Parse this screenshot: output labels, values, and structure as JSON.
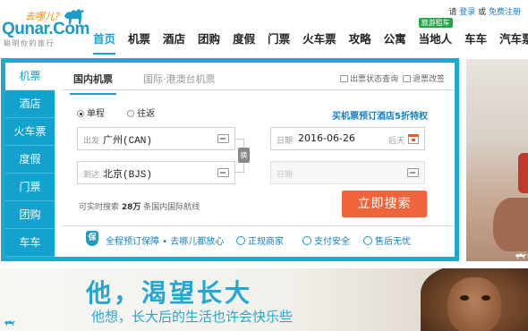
{
  "brand": {
    "slogan": "去哪儿?",
    "name": "Qunar.Com",
    "tagline": "聪明你的旅行"
  },
  "top_links": {
    "prefix": "请",
    "login": "登录",
    "or": "或",
    "register": "免费注册"
  },
  "nav": {
    "items": [
      {
        "label": "首页",
        "active": true
      },
      {
        "label": "机票"
      },
      {
        "label": "酒店"
      },
      {
        "label": "团购"
      },
      {
        "label": "度假"
      },
      {
        "label": "门票"
      },
      {
        "label": "火车票"
      },
      {
        "label": "攻略"
      },
      {
        "label": "公寓"
      },
      {
        "label": "当地人",
        "badge": "旅游租车"
      },
      {
        "label": "车车"
      },
      {
        "label": "汽车票"
      }
    ]
  },
  "side_nav": [
    "机票",
    "酒店",
    "火车票",
    "度假",
    "门票",
    "团购",
    "车车"
  ],
  "tabs": {
    "domestic": "国内机票",
    "international": "国际·港澳台机票",
    "status_query": "出票状态查询",
    "refund": "退票改签"
  },
  "trip_type": {
    "one_way": "单程",
    "round_trip": "往返",
    "selected": "单程"
  },
  "promo_link": "买机票预订酒店5折特权",
  "search_form": {
    "from_label": "出发",
    "from_value": "广州(CAN)",
    "to_label": "到达",
    "to_value": "北京(BJS)",
    "swap_label": "换",
    "depart_label": "日期",
    "depart_value": "2016-06-26",
    "depart_suffix": "后天",
    "return_label": "日期"
  },
  "route_count": {
    "prefix": "可实时搜索",
    "count": "28万",
    "suffix": "条国内国际航线"
  },
  "search_button": "立即搜索",
  "guarantees": {
    "main": "全程预订保障 • 去哪儿都放心",
    "items": [
      "正规商家",
      "支付安全",
      "售后无忧"
    ]
  },
  "banner": {
    "title": "他，渴望长大",
    "subtitle": "他想，长大后的生活也许会快乐些"
  },
  "colors": {
    "accent": "#1ca8d1",
    "search_button": "#f0643c",
    "badge": "#27a34a"
  }
}
